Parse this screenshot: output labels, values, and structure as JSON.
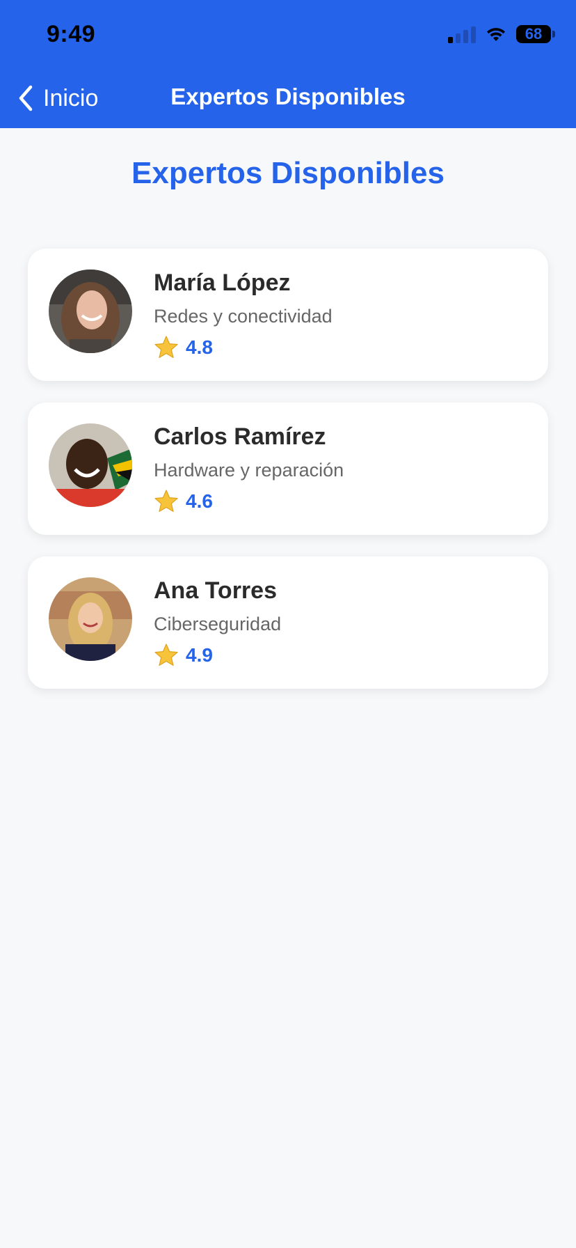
{
  "status_bar": {
    "time": "9:49",
    "battery": "68",
    "icons": [
      "cellular-signal-icon",
      "wifi-icon",
      "battery-icon"
    ]
  },
  "nav": {
    "back_label": "Inicio",
    "title": "Expertos Disponibles"
  },
  "page": {
    "heading": "Expertos Disponibles"
  },
  "experts": [
    {
      "name": "María López",
      "specialty": "Redes y conectividad",
      "rating": "4.8"
    },
    {
      "name": "Carlos Ramírez",
      "specialty": "Hardware y reparación",
      "rating": "4.6"
    },
    {
      "name": "Ana Torres",
      "specialty": "Ciberseguridad",
      "rating": "4.9"
    }
  ],
  "colors": {
    "brand": "#2563eb",
    "background": "#f7f8fa",
    "card": "#ffffff",
    "name_text": "#2b2b2b",
    "secondary_text": "#666666",
    "star": "#f6c33b"
  }
}
